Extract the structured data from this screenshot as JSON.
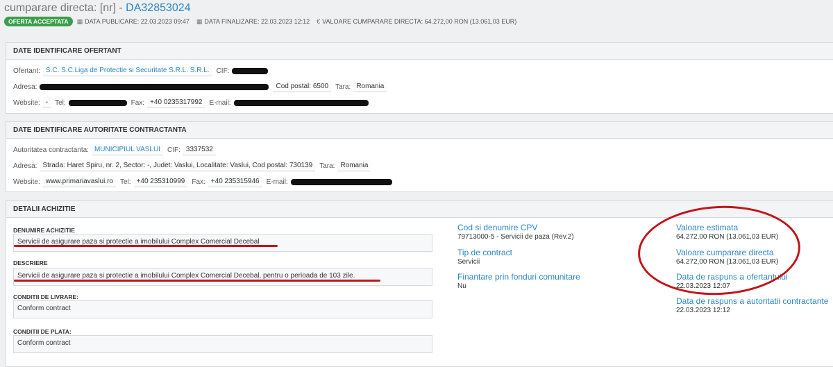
{
  "header": {
    "title_prefix": "cumparare directa: [nr] - ",
    "code": "DA32853024",
    "badge": "OFERTA ACCEPTATA",
    "meta": [
      {
        "icon": "calendar-icon",
        "text": "DATA PUBLICARE: 22.03.2023 09:47"
      },
      {
        "icon": "calendar-icon",
        "text": "DATA FINALIZARE: 22.03.2023 12:12"
      },
      {
        "icon": "euro-icon",
        "text": "VALOARE CUMPARARE DIRECTA: 64.272,00  RON (13.061,03  EUR)"
      }
    ]
  },
  "ofertant": {
    "section_title": "DATE IDENTIFICARE OFERTANT",
    "ofertant_label": "Ofertant:",
    "ofertant_value": "S.C. S.C.Liga de Protectie si Securitate S.R.L. S.R.L.",
    "cif_label": "CIF:",
    "adresa_label": "Adresa:",
    "cod_postal": "Cod postal: 6500",
    "tara_label": "Tara:",
    "tara_value": "Romania",
    "website_label": "Website:",
    "website_value": "-",
    "tel_label": "Tel:",
    "fax_label": "Fax:",
    "fax_value": "+40 0235317992",
    "email_label": "E-mail:"
  },
  "autoritate": {
    "section_title": "DATE IDENTIFICARE AUTORITATE CONTRACTANTA",
    "autoritate_label": "Autoritatea contractanta:",
    "autoritate_value": "MUNICIPIUL VASLUI",
    "cif_label": "CIF:",
    "cif_value": "3337532",
    "adresa_label": "Adresa:",
    "adresa_value": "Strada: Haret Spiru, nr. 2, Sector: -, Judet: Vaslui, Localitate: Vaslui, Cod postal: 730139",
    "tara_label": "Tara:",
    "tara_value": "Romania",
    "website_label": "Website:",
    "website_value": "www.primariavaslui.ro",
    "tel_label": "Tel:",
    "tel_value": "+40 235310999",
    "fax_label": "Fax:",
    "fax_value": "+40 235315946",
    "email_label": "E-mail:"
  },
  "achizitie": {
    "section_title": "DETALII ACHIZITIE",
    "denumire_label": "DENUMIRE ACHIZITIE",
    "denumire_value": "Servicii de asigurare paza si protectie a imobilului Complex Comercial Decebal",
    "descriere_label": "DESCRIERE",
    "descriere_value": "Servicii de asigurare paza si protectie a imobilului Complex Comercial Decebal, pentru o perioada de 103 zile.",
    "livrare_label": "CONDITII DE LIVRARE:",
    "livrare_value": "Conform contract",
    "plata_label": "CONDITII DE PLATA:",
    "plata_value": "Conform contract",
    "cpv_label": "Cod si denumire CPV",
    "cpv_value": "79713000-5 - Servicii de paza (Rev.2)",
    "tip_label": "Tip de contract",
    "tip_value": "Servicii",
    "fonduri_label": "Finantare prin fonduri comunitare",
    "fonduri_value": "Nu",
    "estimata_label": "Valoare estimata",
    "estimata_value": "64.272,00  RON (13.061,03  EUR)",
    "directa_label": "Valoare cumparare directa",
    "directa_value": "64.272,00  RON (13.061,03  EUR)",
    "raspuns_ofertant_label": "Data de raspuns a ofertantului",
    "raspuns_ofertant_value": "22.03.2023 12:07",
    "raspuns_autoritate_label": "Data de raspuns a autoritatii contractante",
    "raspuns_autoritate_value": "22.03.2023 12:12"
  },
  "colors": {
    "link": "#2d86c4",
    "badge": "#3b9e4a",
    "annotation": "#c0151b"
  }
}
